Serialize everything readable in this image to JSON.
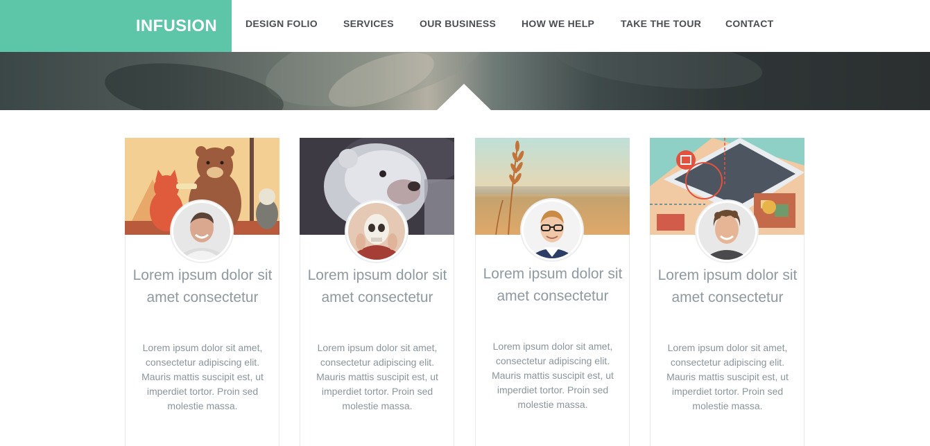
{
  "brand": {
    "name": "INFUSION",
    "color": "#5ec6a8"
  },
  "nav": {
    "items": [
      {
        "label": "DESIGN FOLIO"
      },
      {
        "label": "SERVICES"
      },
      {
        "label": "OUR BUSINESS"
      },
      {
        "label": "HOW WE HELP"
      },
      {
        "label": "TAKE THE TOUR"
      },
      {
        "label": "CONTACT"
      }
    ]
  },
  "cards": [
    {
      "image": "illustration-cat-and-bear",
      "avatar": "man-smiling-portrait",
      "title": "Lorem ipsum dolor sit amet consectetur",
      "text": "Lorem ipsum dolor sit amet, consectetur adipiscing elit. Mauris mattis suscipit est, ut imperdiet tortor. Proin sed molestie massa."
    },
    {
      "image": "illustration-polar-bear",
      "avatar": "person-holding-skull",
      "title": "Lorem ipsum dolor sit amet consectetur",
      "text": "Lorem ipsum dolor sit amet, consectetur adipiscing elit. Mauris mattis suscipit est, ut imperdiet tortor. Proin sed molestie massa."
    },
    {
      "image": "photo-wheat-field",
      "avatar": "man-with-glasses-portrait",
      "title": "Lorem ipsum dolor sit amet consectetur",
      "text": "Lorem ipsum dolor sit amet, consectetur adipiscing elit. Mauris mattis suscipit est, ut imperdiet tortor. Proin sed molestie massa."
    },
    {
      "image": "illustration-smartphone-signals",
      "avatar": "curly-haired-man-portrait",
      "title": "Lorem ipsum dolor sit amet consectetur",
      "text": "Lorem ipsum dolor sit amet, consectetur adipiscing elit. Mauris mattis suscipit est, ut imperdiet tortor. Proin sed molestie massa."
    }
  ]
}
